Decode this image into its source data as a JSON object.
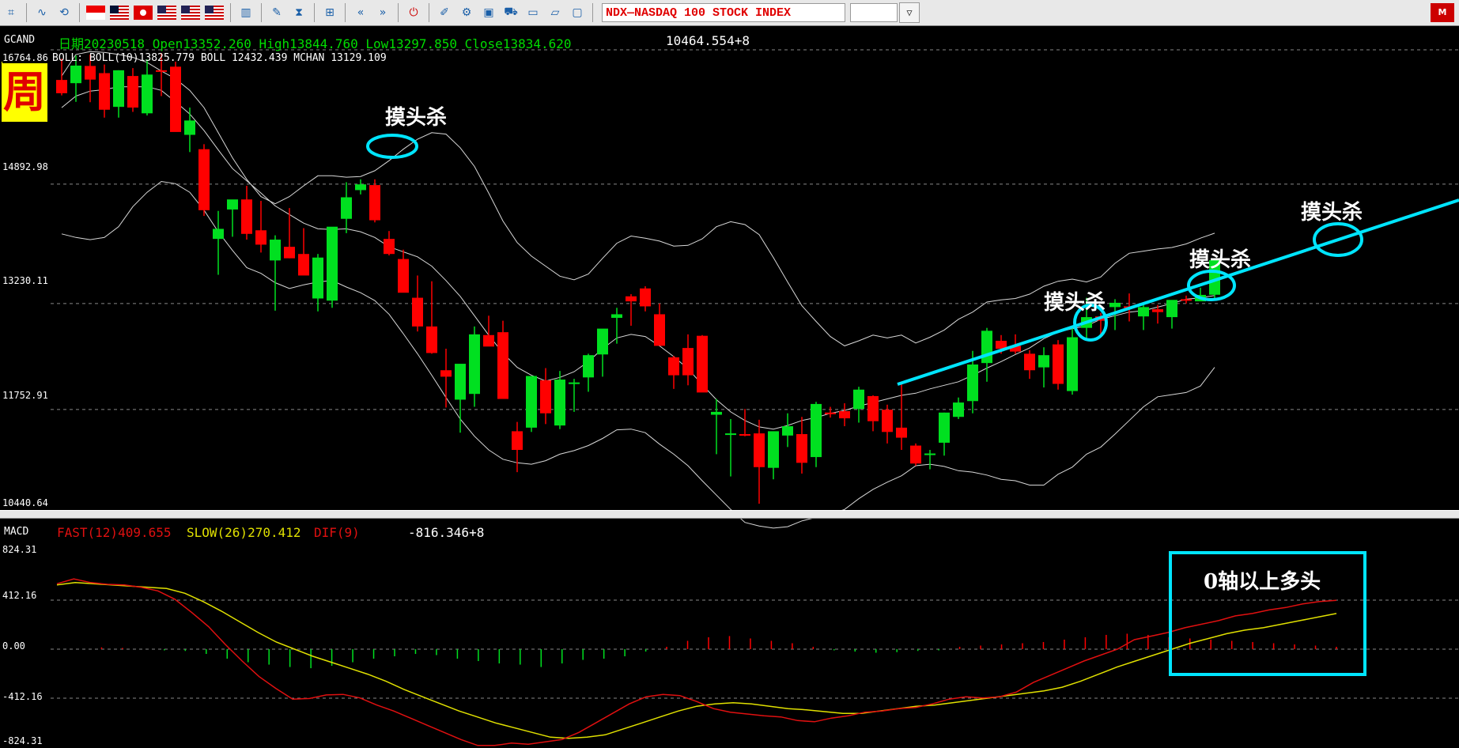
{
  "toolbar": {
    "left_icons": [
      "grid-icon",
      "wave-icon",
      "refresh-icon"
    ],
    "flags": [
      "singapore-flag",
      "malaysia-flag",
      "hongkong-flag",
      "usa-flag",
      "usa-flag",
      "usa-flag"
    ],
    "right_icons": [
      "bar-chart-icon",
      "edit-icon",
      "hourglass-icon",
      "network-icon",
      "rewind-icon",
      "fast-forward-icon",
      "power-icon",
      "draw-icon",
      "gear-icon",
      "window-icon",
      "cart-icon",
      "folder-icon",
      "folder-open-icon",
      "monitor-icon"
    ],
    "symbol_text": "NDX—NASDAQ 100 STOCK INDEX",
    "dropdown_glyph": "▽",
    "brand_text": "M"
  },
  "price_panel": {
    "symbol": "GCAND",
    "info": "日期20230518  Open13352.260  High13844.760  Low13297.850  Close13834.620",
    "extra_value": "10464.554+8",
    "boll": "BOLL:  BOLL(10)13825.779  BOLL  12432.439  MCHAN  13129.109",
    "badge": "周",
    "axis_labels": [
      "16764.86",
      "14892.98",
      "13230.11",
      "11752.91",
      "10440.64"
    ],
    "annotations": [
      "摸头杀",
      "摸头杀",
      "摸头杀",
      "摸头杀"
    ]
  },
  "macd_panel": {
    "label": "MACD",
    "fast": "FAST(12)409.655",
    "slow": "SLOW(26)270.412",
    "dif": "DIF(9)",
    "extra_value": "-816.346+8",
    "axis_labels": [
      "824.31",
      "412.16",
      "0.00",
      "-412.16",
      "-824.31"
    ],
    "annotation": "0轴以上多头"
  },
  "colors": {
    "up": "#00e020",
    "down": "#ff0000",
    "bands": "#d8d8d8",
    "trendline": "#00e5ff",
    "fast": "#e01010",
    "slow": "#e0e000",
    "info": "#00dd00"
  },
  "chart_data": {
    "type": "candlestick",
    "ylim": [
      10440.64,
      16764.86
    ],
    "candles": [
      {
        "o": 16345,
        "h": 16640,
        "l": 16130,
        "c": 16160
      },
      {
        "o": 16300,
        "h": 16685,
        "l": 16040,
        "c": 16545
      },
      {
        "o": 16540,
        "h": 16700,
        "l": 16035,
        "c": 16350
      },
      {
        "o": 16440,
        "h": 16560,
        "l": 15820,
        "c": 15930
      },
      {
        "o": 15970,
        "h": 16480,
        "l": 15820,
        "c": 16480
      },
      {
        "o": 16400,
        "h": 16510,
        "l": 15900,
        "c": 15960
      },
      {
        "o": 15880,
        "h": 16630,
        "l": 15850,
        "c": 16420
      },
      {
        "o": 16480,
        "h": 16720,
        "l": 16120,
        "c": 16470
      },
      {
        "o": 16530,
        "h": 16600,
        "l": 15670,
        "c": 15620
      },
      {
        "o": 15580,
        "h": 15960,
        "l": 15340,
        "c": 15780
      },
      {
        "o": 15380,
        "h": 15450,
        "l": 14450,
        "c": 14530
      },
      {
        "o": 14130,
        "h": 14520,
        "l": 13630,
        "c": 14270
      },
      {
        "o": 14540,
        "h": 14620,
        "l": 14160,
        "c": 14680
      },
      {
        "o": 14680,
        "h": 14870,
        "l": 14120,
        "c": 14200
      },
      {
        "o": 14250,
        "h": 14660,
        "l": 13940,
        "c": 14050
      },
      {
        "o": 13830,
        "h": 14180,
        "l": 13130,
        "c": 14120
      },
      {
        "o": 14020,
        "h": 14560,
        "l": 13860,
        "c": 13860
      },
      {
        "o": 13920,
        "h": 14280,
        "l": 13850,
        "c": 13620
      },
      {
        "o": 13300,
        "h": 13920,
        "l": 13120,
        "c": 13870
      },
      {
        "o": 13270,
        "h": 13960,
        "l": 13170,
        "c": 14300
      },
      {
        "o": 14410,
        "h": 14920,
        "l": 14210,
        "c": 14710
      },
      {
        "o": 14810,
        "h": 14960,
        "l": 14750,
        "c": 14890
      },
      {
        "o": 14880,
        "h": 14960,
        "l": 14360,
        "c": 14390
      },
      {
        "o": 14130,
        "h": 14240,
        "l": 13900,
        "c": 13920
      },
      {
        "o": 13850,
        "h": 13980,
        "l": 13400,
        "c": 13380
      },
      {
        "o": 13310,
        "h": 13620,
        "l": 12840,
        "c": 12910
      },
      {
        "o": 12910,
        "h": 13540,
        "l": 12530,
        "c": 12540
      },
      {
        "o": 12300,
        "h": 12600,
        "l": 11780,
        "c": 12210
      },
      {
        "o": 11890,
        "h": 12360,
        "l": 11430,
        "c": 12390
      },
      {
        "o": 11970,
        "h": 12910,
        "l": 11790,
        "c": 12800
      },
      {
        "o": 12790,
        "h": 13060,
        "l": 12640,
        "c": 12630
      },
      {
        "o": 12830,
        "h": 12990,
        "l": 11960,
        "c": 11900
      },
      {
        "o": 11450,
        "h": 11580,
        "l": 10880,
        "c": 11190
      },
      {
        "o": 11500,
        "h": 12120,
        "l": 11440,
        "c": 12220
      },
      {
        "o": 12160,
        "h": 12330,
        "l": 11550,
        "c": 11700
      },
      {
        "o": 11530,
        "h": 12290,
        "l": 11480,
        "c": 12170
      },
      {
        "o": 12110,
        "h": 12180,
        "l": 11720,
        "c": 12130
      },
      {
        "o": 12200,
        "h": 12530,
        "l": 12000,
        "c": 12510
      },
      {
        "o": 12520,
        "h": 12860,
        "l": 12210,
        "c": 12880
      },
      {
        "o": 13030,
        "h": 13170,
        "l": 12670,
        "c": 13080
      },
      {
        "o": 13330,
        "h": 13360,
        "l": 12920,
        "c": 13260
      },
      {
        "o": 13440,
        "h": 13470,
        "l": 13120,
        "c": 13190
      },
      {
        "o": 13080,
        "h": 13230,
        "l": 12690,
        "c": 12640
      },
      {
        "o": 12480,
        "h": 12500,
        "l": 12040,
        "c": 12230
      },
      {
        "o": 12610,
        "h": 12800,
        "l": 12090,
        "c": 12230
      },
      {
        "o": 12780,
        "h": 12790,
        "l": 12150,
        "c": 11990
      },
      {
        "o": 11680,
        "h": 11900,
        "l": 11130,
        "c": 11720
      },
      {
        "o": 11400,
        "h": 11620,
        "l": 10820,
        "c": 11420
      },
      {
        "o": 11410,
        "h": 11760,
        "l": 11380,
        "c": 11400
      },
      {
        "o": 11420,
        "h": 11610,
        "l": 10440,
        "c": 10950
      },
      {
        "o": 10940,
        "h": 11440,
        "l": 10780,
        "c": 11450
      },
      {
        "o": 11390,
        "h": 11700,
        "l": 11230,
        "c": 11520
      },
      {
        "o": 11410,
        "h": 11650,
        "l": 10860,
        "c": 11010
      },
      {
        "o": 11090,
        "h": 11860,
        "l": 10950,
        "c": 11830
      },
      {
        "o": 11710,
        "h": 11790,
        "l": 11640,
        "c": 11690
      },
      {
        "o": 11730,
        "h": 11840,
        "l": 11520,
        "c": 11630
      },
      {
        "o": 11760,
        "h": 12070,
        "l": 11570,
        "c": 12030
      },
      {
        "o": 11940,
        "h": 11950,
        "l": 11450,
        "c": 11590
      },
      {
        "o": 11750,
        "h": 11820,
        "l": 11280,
        "c": 11440
      },
      {
        "o": 11500,
        "h": 12140,
        "l": 11190,
        "c": 11360
      },
      {
        "o": 11250,
        "h": 11280,
        "l": 10970,
        "c": 11000
      },
      {
        "o": 11140,
        "h": 11190,
        "l": 10920,
        "c": 11140
      },
      {
        "o": 11290,
        "h": 11710,
        "l": 11110,
        "c": 11710
      },
      {
        "o": 11650,
        "h": 11920,
        "l": 11620,
        "c": 11850
      },
      {
        "o": 11870,
        "h": 12570,
        "l": 11700,
        "c": 12380
      },
      {
        "o": 12400,
        "h": 12890,
        "l": 12140,
        "c": 12850
      },
      {
        "o": 12710,
        "h": 12790,
        "l": 12530,
        "c": 12600
      },
      {
        "o": 12640,
        "h": 12800,
        "l": 12530,
        "c": 12560
      },
      {
        "o": 12530,
        "h": 12580,
        "l": 12180,
        "c": 12300
      },
      {
        "o": 12340,
        "h": 12620,
        "l": 12060,
        "c": 12510
      },
      {
        "o": 12660,
        "h": 12720,
        "l": 12030,
        "c": 12110
      },
      {
        "o": 12010,
        "h": 12920,
        "l": 11960,
        "c": 12760
      },
      {
        "o": 12890,
        "h": 13310,
        "l": 12740,
        "c": 13040
      },
      {
        "o": 13050,
        "h": 13100,
        "l": 12770,
        "c": 12990
      },
      {
        "o": 13180,
        "h": 13290,
        "l": 12860,
        "c": 13240
      },
      {
        "o": 13190,
        "h": 13370,
        "l": 12980,
        "c": 13170
      },
      {
        "o": 13050,
        "h": 13220,
        "l": 12860,
        "c": 13180
      },
      {
        "o": 13150,
        "h": 13210,
        "l": 12950,
        "c": 13110
      },
      {
        "o": 13040,
        "h": 13250,
        "l": 12880,
        "c": 13280
      },
      {
        "o": 13290,
        "h": 13340,
        "l": 13230,
        "c": 13270
      },
      {
        "o": 13260,
        "h": 13450,
        "l": 13280,
        "c": 13350
      },
      {
        "o": 13352,
        "h": 13844,
        "l": 13297,
        "c": 13834
      }
    ],
    "upper_band": [
      16400,
      16700,
      16740,
      16730,
      16700,
      16660,
      16590,
      16470,
      16360,
      16200,
      15960,
      15610,
      15260,
      14960,
      14720,
      14620,
      14720,
      14870,
      15010,
      15010,
      14990,
      15000,
      15080,
      15220,
      15380,
      15520,
      15610,
      15590,
      15400,
      15140,
      14770,
      14380,
      14080,
      13890,
      13750,
      13610,
      13560,
      13640,
      13860,
      14070,
      14170,
      14140,
      14100,
      14030,
      14040,
      14130,
      14300,
      14370,
      14330,
      14190,
      13870,
      13530,
      13200,
      12980,
      12770,
      12640,
      12710,
      12790,
      12750,
      12790,
      12680,
      12760,
      12860,
      13010,
      13110,
      13250,
      13280,
      13300,
      13360,
      13470,
      13540,
      13570,
      13530,
      13600,
      13790,
      13930,
      13960,
      13990,
      14010,
      14060,
      14140,
      14210
    ],
    "mid_band": [
      15960,
      16120,
      16190,
      16210,
      16250,
      16250,
      16250,
      16200,
      16040,
      15870,
      15640,
      15370,
      15110,
      14940,
      14770,
      14590,
      14470,
      14350,
      14270,
      14260,
      14270,
      14230,
      14150,
      14020,
      13950,
      13880,
      13750,
      13550,
      13330,
      13060,
      12790,
      12540,
      12340,
      12230,
      12150,
      12200,
      12280,
      12420,
      12600,
      12750,
      12800,
      12770,
      12640,
      12490,
      12320,
      12100,
      11890,
      11720,
      11600,
      11510,
      11480,
      11530,
      11600,
      11640,
      11700,
      11740,
      11800,
      11850,
      11900,
      11950,
      11980,
      12040,
      12090,
      12140,
      12230,
      12330,
      12420,
      12520,
      12610,
      12740,
      12830,
      12880,
      12920,
      13010,
      13060,
      13110,
      13130,
      13180,
      13230,
      13290,
      13310,
      13340
    ],
    "lower_band": [
      14200,
      14150,
      14120,
      14150,
      14300,
      14580,
      14780,
      14930,
      14900,
      14780,
      14530,
      14230,
      13970,
      13730,
      13650,
      13520,
      13440,
      13490,
      13530,
      13550,
      13460,
      13380,
      13270,
      13080,
      12810,
      12530,
      12230,
      11920,
      11620,
      11380,
      11190,
      11060,
      11010,
      10990,
      11040,
      11130,
      11180,
      11250,
      11350,
      11470,
      11480,
      11430,
      11270,
      11130,
      10970,
      10760,
      10560,
      10360,
      10180,
      10130,
      10100,
      10120,
      10200,
      10250,
      10300,
      10360,
      10510,
      10640,
      10740,
      10830,
      10970,
      10990,
      10960,
      10900,
      10880,
      10840,
      10780,
      10760,
      10700,
      10700,
      10850,
      10950,
      11130,
      11230,
      11410,
      11600,
      11790,
      11930,
      11960,
      11990,
      12080,
      12340
    ],
    "macd_ylim": [
      -824.31,
      824.31
    ],
    "macd_fast": [
      550,
      590,
      560,
      545,
      540,
      520,
      490,
      420,
      310,
      190,
      40,
      -100,
      -230,
      -330,
      -420,
      -415,
      -385,
      -380,
      -410,
      -470,
      -520,
      -580,
      -640,
      -700,
      -760,
      -810,
      -810,
      -790,
      -800,
      -780,
      -760,
      -700,
      -620,
      -540,
      -460,
      -400,
      -380,
      -390,
      -440,
      -500,
      -530,
      -545,
      -560,
      -570,
      -600,
      -610,
      -580,
      -560,
      -530,
      -520,
      -500,
      -490,
      -460,
      -420,
      -400,
      -410,
      -400,
      -360,
      -280,
      -220,
      -160,
      -100,
      -50,
      0,
      80,
      110,
      140,
      180,
      210,
      240,
      280,
      300,
      330,
      350,
      380,
      400,
      410
    ],
    "macd_slow": [
      540,
      560,
      550,
      540,
      530,
      520,
      510,
      470,
      400,
      320,
      230,
      140,
      60,
      0,
      -60,
      -110,
      -160,
      -210,
      -270,
      -340,
      -400,
      -460,
      -520,
      -570,
      -620,
      -660,
      -700,
      -740,
      -750,
      -740,
      -720,
      -670,
      -620,
      -570,
      -520,
      -480,
      -460,
      -450,
      -460,
      -480,
      -500,
      -510,
      -525,
      -540,
      -540,
      -520,
      -500,
      -480,
      -470,
      -450,
      -430,
      -410,
      -390,
      -370,
      -350,
      -320,
      -270,
      -210,
      -150,
      -100,
      -50,
      0,
      50,
      90,
      130,
      160,
      180,
      210,
      240,
      270,
      300
    ],
    "macd_hist": [
      0,
      15,
      10,
      0,
      -10,
      -15,
      -40,
      -80,
      -110,
      -130,
      -150,
      -160,
      -140,
      -110,
      -80,
      -60,
      -40,
      -50,
      -80,
      -100,
      -120,
      -130,
      -150,
      -120,
      -90,
      -80,
      -60,
      -20,
      20,
      70,
      100,
      110,
      90,
      70,
      50,
      20,
      -10,
      -20,
      -30,
      -25,
      -15,
      -10,
      20,
      30,
      40,
      50,
      60,
      80,
      100,
      120,
      130,
      120,
      100,
      90,
      80,
      70,
      60,
      50,
      40,
      30,
      20
    ]
  }
}
